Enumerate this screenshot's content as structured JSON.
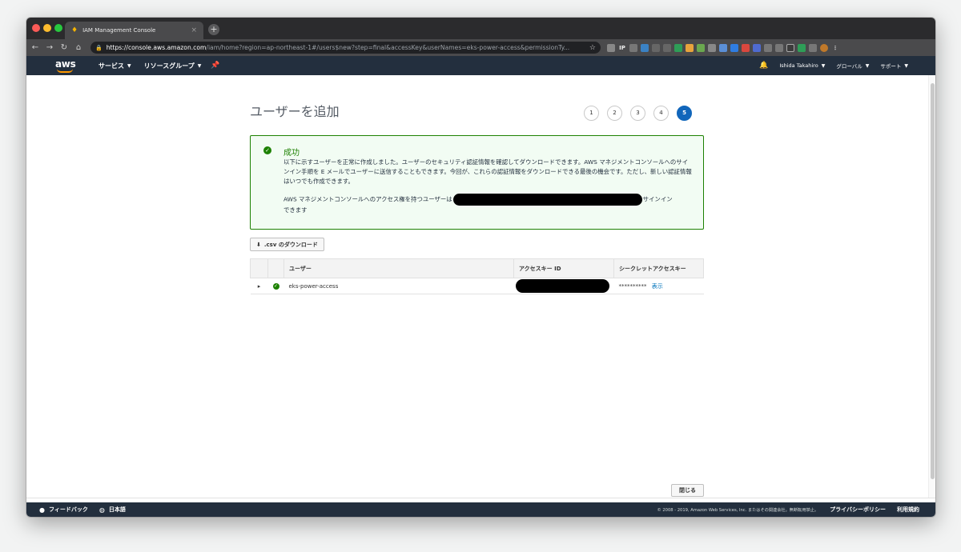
{
  "browser": {
    "tab_title": "IAM Management Console",
    "tab_close": "×",
    "new_tab": "+",
    "url_host": "https://console.aws.amazon.com",
    "url_path": "/iam/home?region=ap-northeast-1#/users$new?step=final&accessKey&userNames=eks-power-access&permissionTy..."
  },
  "nav": {
    "logo": "aws",
    "services": "サービス",
    "resource_groups": "リソースグループ",
    "user": "Ishida Takahiro",
    "region": "グローバル",
    "support": "サポート"
  },
  "page": {
    "title": "ユーザーを追加",
    "steps": [
      "1",
      "2",
      "3",
      "4",
      "5"
    ],
    "active_step": 5
  },
  "alert": {
    "title": "成功",
    "body": "以下に示すユーザーを正常に作成しました。ユーザーのセキュリティ認証情報を確認してダウンロードできます。AWS マネジメントコンソールへのサインイン手順を E メールでユーザーに送信することもできます。今回が、これらの認証情報をダウンロードできる最後の機会です。ただし、新しい認証情報はいつでも作成できます。",
    "signin_prefix": "AWS マネジメントコンソールへのアクセス権を持つユーザーは",
    "signin_suffix": "サインイン",
    "signin_tail": "できます"
  },
  "csv_button": ".csv のダウンロード",
  "table": {
    "headers": [
      "ユーザー",
      "アクセスキー ID",
      "シークレットアクセスキー"
    ],
    "rows": [
      {
        "user": "eks-power-access",
        "secret_mask": "**********",
        "show_label": "表示"
      }
    ]
  },
  "close_button": "閉じる",
  "footer": {
    "feedback": "フィードバック",
    "language": "日本語",
    "copyright": "© 2008 - 2019, Amazon Web Services, Inc. またはその関連会社。無断転用禁止。",
    "privacy": "プライバシーポリシー",
    "terms": "利用規約"
  },
  "icons": {
    "lock": "lock-icon",
    "star": "star-icon",
    "bell": "bell-icon",
    "pin": "pin-icon",
    "check": "check-circle-icon",
    "download": "download-icon",
    "globe": "globe-icon",
    "chat": "chat-bubble-icon"
  },
  "colors": {
    "aws_navy": "#232f3e",
    "aws_orange": "#ff9900",
    "success_green": "#1d8102",
    "link_blue": "#0073bb",
    "step_active": "#1166bb"
  }
}
